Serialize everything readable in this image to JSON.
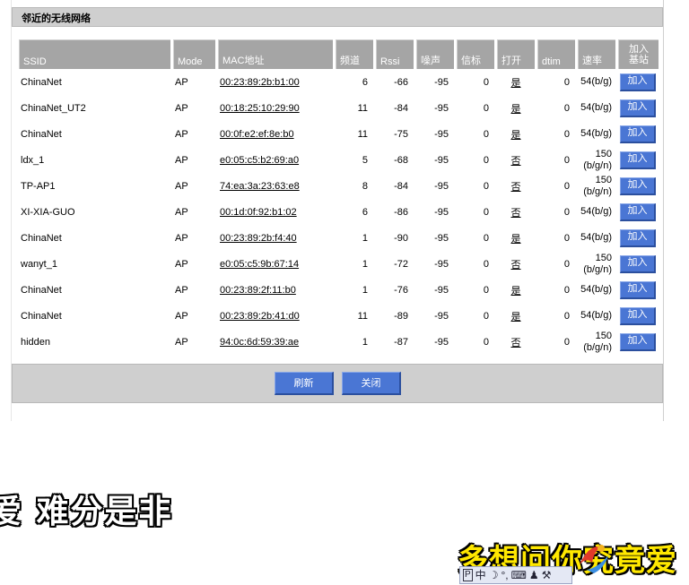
{
  "panel": {
    "title": "邻近的无线网络"
  },
  "columns": [
    "SSID",
    "Mode",
    "MAC地址",
    "频道",
    "Rssi",
    "噪声",
    "信标",
    "打开",
    "dtim",
    "速率",
    "加入\n基站"
  ],
  "rows": [
    {
      "ssid": "ChinaNet",
      "mode": "AP",
      "mac": "00:23:89:2b:b1:00",
      "channel": "6",
      "rssi": "-66",
      "noise": "-95",
      "beacon": "0",
      "open": "是",
      "dtim": "0",
      "rate": "54(b/g)",
      "join": "加入"
    },
    {
      "ssid": "ChinaNet_UT2",
      "mode": "AP",
      "mac": "00:18:25:10:29:90",
      "channel": "11",
      "rssi": "-84",
      "noise": "-95",
      "beacon": "0",
      "open": "是",
      "dtim": "0",
      "rate": "54(b/g)",
      "join": "加入"
    },
    {
      "ssid": "ChinaNet",
      "mode": "AP",
      "mac": "00:0f:e2:ef:8e:b0",
      "channel": "11",
      "rssi": "-75",
      "noise": "-95",
      "beacon": "0",
      "open": "是",
      "dtim": "0",
      "rate": "54(b/g)",
      "join": "加入"
    },
    {
      "ssid": "ldx_1",
      "mode": "AP",
      "mac": "e0:05:c5:b2:69:a0",
      "channel": "5",
      "rssi": "-68",
      "noise": "-95",
      "beacon": "0",
      "open": "否",
      "dtim": "0",
      "rate": "150\n(b/g/n)",
      "join": "加入"
    },
    {
      "ssid": "TP-AP1",
      "mode": "AP",
      "mac": "74:ea:3a:23:63:e8",
      "channel": "8",
      "rssi": "-84",
      "noise": "-95",
      "beacon": "0",
      "open": "否",
      "dtim": "0",
      "rate": "150\n(b/g/n)",
      "join": "加入"
    },
    {
      "ssid": "XI-XIA-GUO",
      "mode": "AP",
      "mac": "00:1d:0f:92:b1:02",
      "channel": "6",
      "rssi": "-86",
      "noise": "-95",
      "beacon": "0",
      "open": "否",
      "dtim": "0",
      "rate": "54(b/g)",
      "join": "加入"
    },
    {
      "ssid": "ChinaNet",
      "mode": "AP",
      "mac": "00:23:89:2b:f4:40",
      "channel": "1",
      "rssi": "-90",
      "noise": "-95",
      "beacon": "0",
      "open": "是",
      "dtim": "0",
      "rate": "54(b/g)",
      "join": "加入"
    },
    {
      "ssid": "wanyt_1",
      "mode": "AP",
      "mac": "e0:05:c5:9b:67:14",
      "channel": "1",
      "rssi": "-72",
      "noise": "-95",
      "beacon": "0",
      "open": "否",
      "dtim": "0",
      "rate": "150\n(b/g/n)",
      "join": "加入"
    },
    {
      "ssid": "ChinaNet",
      "mode": "AP",
      "mac": "00:23:89:2f:11:b0",
      "channel": "1",
      "rssi": "-76",
      "noise": "-95",
      "beacon": "0",
      "open": "是",
      "dtim": "0",
      "rate": "54(b/g)",
      "join": "加入"
    },
    {
      "ssid": "ChinaNet",
      "mode": "AP",
      "mac": "00:23:89:2b:41:d0",
      "channel": "11",
      "rssi": "-89",
      "noise": "-95",
      "beacon": "0",
      "open": "是",
      "dtim": "0",
      "rate": "54(b/g)",
      "join": "加入"
    },
    {
      "ssid": "hidden",
      "mode": "AP",
      "mac": "94:0c:6d:59:39:ae",
      "channel": "1",
      "rssi": "-87",
      "noise": "-95",
      "beacon": "0",
      "open": "否",
      "dtim": "0",
      "rate": "150\n(b/g/n)",
      "join": "加入"
    }
  ],
  "footer": {
    "refresh_label": "刷新",
    "close_label": "关闭"
  },
  "overlay": {
    "caption_left": "爱 难分是非",
    "caption_right": "多想问你究竟爱"
  },
  "ime": {
    "items": [
      "P",
      "中",
      "☽",
      "°,",
      "⌨",
      "♟",
      "⚒"
    ]
  },
  "colors": {
    "header_bg": "#a5a5a5",
    "bar_bg": "#cfcfcf",
    "button_bg": "#4a76d4"
  }
}
